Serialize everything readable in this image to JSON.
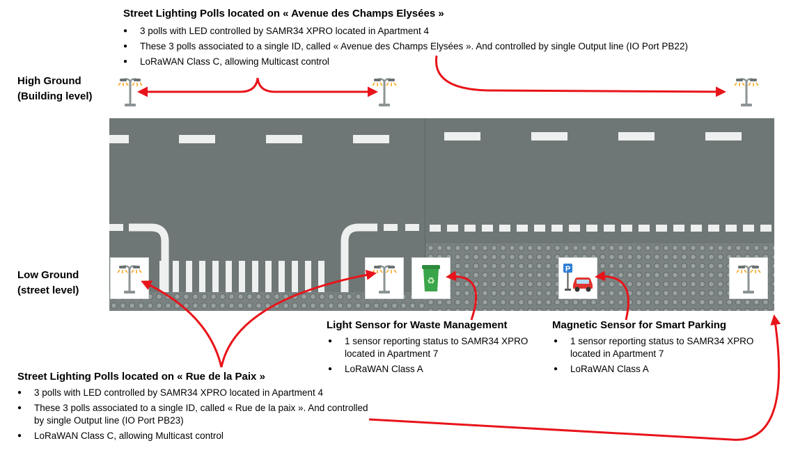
{
  "top_block": {
    "title": "Street Lighting Polls located on « Avenue des Champs Elysées »",
    "bullets": [
      "3 polls with LED controlled by SAMR34 XPRO located in Apartment 4",
      "These 3 polls associated to a single ID, called « Avenue des Champs Elysées ». And controlled by single Output line (IO Port PB22)",
      "LoRaWAN Class C, allowing Multicast control"
    ]
  },
  "high_ground": {
    "line1": "High Ground",
    "line2": "(Building level)"
  },
  "low_ground": {
    "line1": "Low Ground",
    "line2": "(street level)"
  },
  "waste_block": {
    "title": "Light Sensor for Waste Management",
    "bullets": [
      "1 sensor reporting status to SAMR34 XPRO located in Apartment 7",
      "LoRaWAN Class A"
    ]
  },
  "parking_block": {
    "title": "Magnetic Sensor for Smart Parking",
    "bullets": [
      "1 sensor reporting status to SAMR34 XPRO located in Apartment 7",
      "LoRaWAN Class A"
    ]
  },
  "bottom_block": {
    "title": "Street Lighting Polls located on « Rue de la Paix »",
    "bullets": [
      "3 polls with LED controlled by SAMR34 XPRO located in Apartment 4",
      "These 3 polls associated to a single ID, called « Rue de la paix ». And controlled by single Output line (IO Port PB23)",
      "LoRaWAN Class C, allowing Multicast control"
    ]
  },
  "icons": {
    "street_lamp": "street-lamp-icon",
    "waste_bin": "recycling-bin-icon",
    "parking": "parking-car-icon",
    "parking_letter": "P"
  },
  "colors": {
    "arrow": "#e8141a",
    "road": "#6f7676",
    "bin": "#3aa54a",
    "parking_sign": "#2f7fd6",
    "car": "#e0342f"
  }
}
